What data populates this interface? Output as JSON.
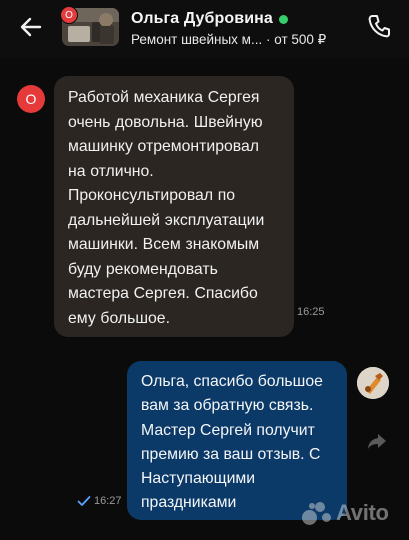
{
  "header": {
    "contact_name": "Ольга Дубровина",
    "ad_title": "Ремонт швейных м...",
    "price": "от 500 ₽",
    "subtitle_separator": "·",
    "badge_letter": "О"
  },
  "messages": [
    {
      "direction": "incoming",
      "avatar_letter": "О",
      "text": "Работой механика Сергея очень довольна.  Швейную машинку отремонтировал на отлично. Проконсультировал по дальнейшей эксплуатации машинки. Всем знакомым буду рекомендовать мастера Сергея. Спасибо ему большое.",
      "time": "16:25"
    },
    {
      "direction": "outgoing",
      "text": "Ольга, спасибо большое вам за обратную связь. Мастер Сергей получит премию за ваш отзыв. С Наступающими праздниками",
      "time": "16:27",
      "status": "read"
    }
  ],
  "watermark": {
    "brand": "Avito"
  },
  "colors": {
    "background": "#0b0b0b",
    "incoming_bubble": "#2b2622",
    "outgoing_bubble": "#0c3a68",
    "avatar_red": "#e5393a",
    "online_green": "#35d06b"
  },
  "icons": [
    "back-arrow-icon",
    "phone-icon",
    "online-indicator",
    "read-check-icon",
    "share-icon",
    "avito-logo"
  ]
}
